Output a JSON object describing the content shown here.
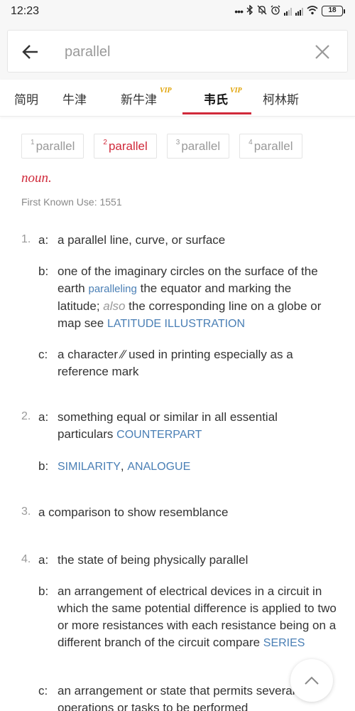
{
  "status_bar": {
    "time": "12:23",
    "dots": "•••",
    "battery": "18"
  },
  "search": {
    "query": "parallel"
  },
  "tabs": [
    {
      "label": "简明",
      "vip": ""
    },
    {
      "label": "牛津",
      "vip": ""
    },
    {
      "label": "新牛津",
      "vip": "VIP"
    },
    {
      "label": "韦氏",
      "vip": "VIP"
    },
    {
      "label": "柯林斯",
      "vip": ""
    }
  ],
  "senses": [
    {
      "sup": "1",
      "word": "parallel"
    },
    {
      "sup": "2",
      "word": "parallel"
    },
    {
      "sup": "3",
      "word": "parallel"
    },
    {
      "sup": "4",
      "word": "parallel"
    }
  ],
  "entry": {
    "pos": "noun.",
    "first_known_use": "First Known Use: 1551"
  },
  "defs": {
    "d1": {
      "num": "1.",
      "a_letter": "a:",
      "a_text": "a parallel line, curve, or surface",
      "b_letter": "b:",
      "b_text1": "one of the imaginary circles on the surface of the earth ",
      "b_link1": "paralleling",
      "b_text2": " the equator and marking the latitude; ",
      "b_also": "also",
      "b_text3": " the corresponding line on a globe or map see ",
      "b_link2": "LATITUDE ILLUSTRATION",
      "c_letter": "c:",
      "c_text": "a character ∕∕ used in printing especially as a reference mark"
    },
    "d2": {
      "num": "2.",
      "a_letter": "a:",
      "a_text": "something equal or similar in all essential particulars ",
      "a_link": "COUNTERPART",
      "b_letter": "b:",
      "b_link1": "SIMILARITY",
      "b_sep": ", ",
      "b_link2": "ANALOGUE"
    },
    "d3": {
      "num": "3.",
      "text": "a comparison to show resemblance"
    },
    "d4": {
      "num": "4.",
      "a_letter": "a:",
      "a_text": "the state of being physically parallel",
      "b_letter": "b:",
      "b_text": "an arrangement of electrical devices in a circuit in which the same potential difference is applied to two or more resistances with each resistance being on a different branch of the circuit compare ",
      "b_link": "SERIES",
      "c_letter": "c:",
      "c_text": "an arrangement or state that permits several operations or tasks to be performed"
    }
  },
  "colors": {
    "accent": "#d0293a",
    "link": "#4a7fb5",
    "vip": "#e0a100"
  }
}
